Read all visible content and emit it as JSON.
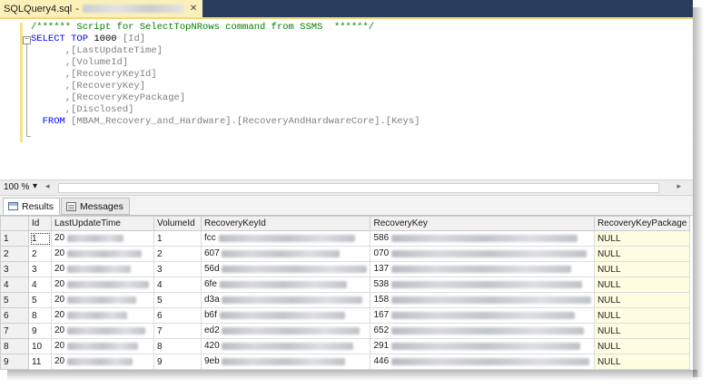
{
  "document_tab": {
    "title": "SQLQuery4.sql",
    "separator": "-"
  },
  "editor": {
    "comment": "/****** Script for SelectTopNRows command from SSMS  ******/",
    "select_kw": "SELECT",
    "top_kw": "TOP",
    "top_count": "1000",
    "first_column": "[Id]",
    "columns": [
      ",[LastUpdateTime]",
      ",[VolumeId]",
      ",[RecoveryKeyId]",
      ",[RecoveryKey]",
      ",[RecoveryKeyPackage]",
      ",[Disclosed]"
    ],
    "from_kw": "FROM",
    "table": "[MBAM_Recovery_and_Hardware].[RecoveryAndHardwareCore].[Keys]"
  },
  "zoom": {
    "value": "100 %",
    "arrow": "▾"
  },
  "results_tabs": [
    {
      "label": "Results",
      "icon": "grid-icon",
      "active": true
    },
    {
      "label": "Messages",
      "icon": "messages-icon",
      "active": false
    }
  ],
  "grid": {
    "columns": [
      "Id",
      "LastUpdateTime",
      "VolumeId",
      "RecoveryKeyId",
      "RecoveryKey",
      "RecoveryKeyPackage"
    ],
    "rows": [
      {
        "rownum": "1",
        "id": "1",
        "time": "20",
        "vol": "1",
        "keyid": "fcc",
        "key": "586",
        "pkg": "NULL"
      },
      {
        "rownum": "2",
        "id": "2",
        "time": "20",
        "vol": "2",
        "keyid": "607",
        "key": "070",
        "pkg": "NULL"
      },
      {
        "rownum": "3",
        "id": "3",
        "time": "20",
        "vol": "3",
        "keyid": "56d",
        "key": "137",
        "pkg": "NULL"
      },
      {
        "rownum": "4",
        "id": "4",
        "time": "20",
        "vol": "4",
        "keyid": "6fe",
        "key": "538",
        "pkg": "NULL"
      },
      {
        "rownum": "5",
        "id": "5",
        "time": "20",
        "vol": "5",
        "keyid": "d3a",
        "key": "158",
        "pkg": "NULL"
      },
      {
        "rownum": "6",
        "id": "8",
        "time": "20",
        "vol": "6",
        "keyid": "b6f",
        "key": "167",
        "pkg": "NULL"
      },
      {
        "rownum": "7",
        "id": "9",
        "time": "20",
        "vol": "7",
        "keyid": "ed2",
        "key": "652",
        "pkg": "NULL"
      },
      {
        "rownum": "8",
        "id": "10",
        "time": "20",
        "vol": "8",
        "keyid": "420",
        "key": "291",
        "pkg": "NULL"
      },
      {
        "rownum": "9",
        "id": "11",
        "time": "20",
        "vol": "9",
        "keyid": "9eb",
        "key": "446",
        "pkg": "NULL"
      }
    ]
  },
  "colors": {
    "tab_bg": "#fbf0b9",
    "tabstrip_bg": "#2b3d5c",
    "keyword": "#0000ff",
    "comment": "#008000",
    "identifier": "#808080",
    "null_cell_bg": "#fffde1"
  }
}
